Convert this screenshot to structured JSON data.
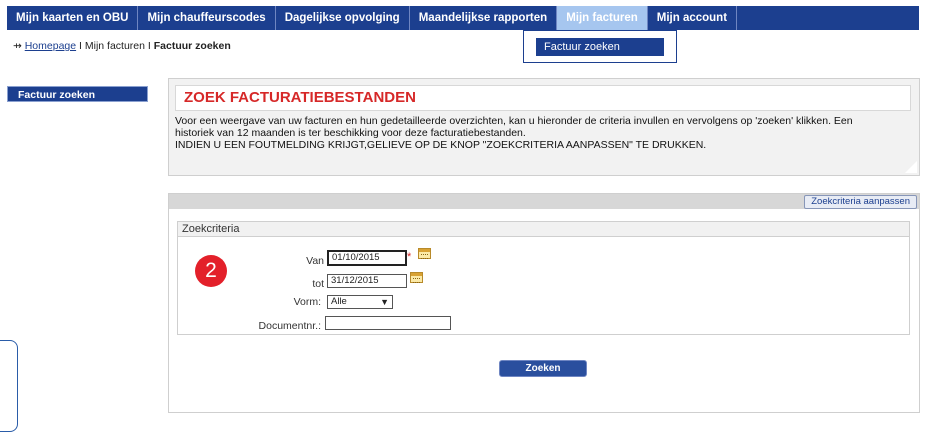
{
  "nav": {
    "items": [
      {
        "label": "Mijn kaarten en OBU"
      },
      {
        "label": "Mijn chauffeurscodes"
      },
      {
        "label": "Dagelijkse opvolging"
      },
      {
        "label": "Maandelijkse rapporten"
      },
      {
        "label": "Mijn facturen"
      },
      {
        "label": "Mijn account"
      }
    ],
    "active_index": 4,
    "dropdown": {
      "item": "Factuur zoeken"
    }
  },
  "breadcrumb": {
    "home": "Homepage",
    "sep1": " I ",
    "section": "Mijn facturen",
    "sep2": " I ",
    "current": "Factuur zoeken"
  },
  "sidebar": {
    "items": [
      {
        "label": "Factuur zoeken"
      }
    ]
  },
  "info": {
    "title": "ZOEK FACTURATIEBESTANDEN",
    "line1": "Voor een weergave van uw facturen en hun gedetailleerde overzichten, kan u hieronder de criteria invullen en vervolgens op 'zoeken' klikken. Een",
    "line2": "historiek van 12 maanden is ter beschikking voor deze facturatiebestanden.",
    "line3": "INDIEN U EEN FOUTMELDING KRIJGT,GELIEVE OP DE KNOP \"ZOEKCRITERIA AANPASSEN\" TE DRUKKEN."
  },
  "search": {
    "adjust_button": "Zoekcriteria aanpassen",
    "criteria_title": "Zoekcriteria",
    "van_label": "Van",
    "van_value": "01/10/2015",
    "required_mark": "*",
    "tot_label": "tot",
    "tot_value": "31/12/2015",
    "vorm_label": "Vorm:",
    "vorm_value": "Alle",
    "docnr_label": "Documentnr.:",
    "docnr_value": "",
    "submit": "Zoeken"
  },
  "step_badge": "2",
  "colors": {
    "nav": "#1c3f8f",
    "title_red": "#d62828",
    "badge": "#e3202a",
    "nav_active": "#a6c6ef"
  }
}
